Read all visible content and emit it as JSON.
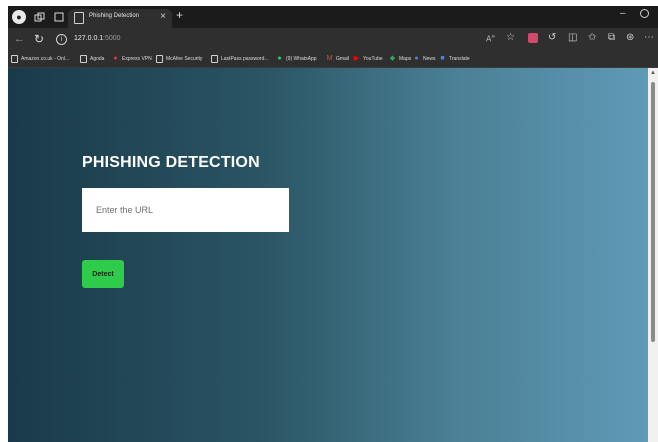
{
  "browser": {
    "tab_title": "Phishing Detection",
    "tab_close_glyph": "×",
    "new_tab_glyph": "+",
    "url_host": "127.0.0.1",
    "url_port": ":5000",
    "bookmarks": [
      {
        "label": "Amazon.co.uk - Onl...",
        "icon": "page-icon"
      },
      {
        "label": "Agoda",
        "icon": "page-icon"
      },
      {
        "label": "Express VPN",
        "icon": "expressvpn-icon",
        "color": "#da3940"
      },
      {
        "label": "McAfee Security",
        "icon": "page-icon"
      },
      {
        "label": "LastPass password...",
        "icon": "page-icon"
      },
      {
        "label": "(9) WhatsApp",
        "icon": "whatsapp-icon",
        "color": "#25d366"
      },
      {
        "label": "Gmail",
        "icon": "gmail-icon",
        "color": "#ea4335"
      },
      {
        "label": "YouTube",
        "icon": "youtube-icon",
        "color": "#ff0000"
      },
      {
        "label": "Maps",
        "icon": "maps-icon",
        "color": "#34a853"
      },
      {
        "label": "News",
        "icon": "news-icon",
        "color": "#4285f4"
      },
      {
        "label": "Translate",
        "icon": "translate-icon",
        "color": "#4285f4"
      }
    ]
  },
  "page": {
    "heading": "PHISHING DETECTION",
    "url_placeholder": "Enter the URL",
    "detect_label": "Detect"
  },
  "colors": {
    "detect_button": "#2ecc4a",
    "gradient_start": "#1a3a4a",
    "gradient_end": "#5f9ab6"
  }
}
